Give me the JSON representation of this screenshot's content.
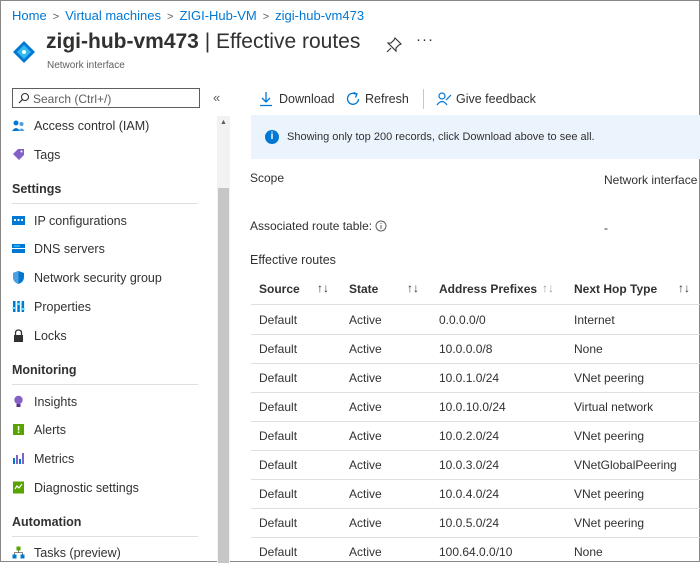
{
  "breadcrumb": [
    "Home",
    "Virtual machines",
    "ZIGI-Hub-VM",
    "zigi-hub-vm473"
  ],
  "header": {
    "resource_name": "zigi-hub-vm473",
    "blade_title": "| Effective routes",
    "subtitle": "Network interface",
    "more_label": "···"
  },
  "sidebar": {
    "search_placeholder": "Search (Ctrl+/)",
    "collapse_label": "«",
    "top_items": [
      {
        "label": "Access control (IAM)",
        "icon": "people-icon"
      },
      {
        "label": "Tags",
        "icon": "tag-icon"
      }
    ],
    "sections": [
      {
        "title": "Settings",
        "items": [
          {
            "label": "IP configurations",
            "icon": "ip-config-icon"
          },
          {
            "label": "DNS servers",
            "icon": "dns-icon"
          },
          {
            "label": "Network security group",
            "icon": "shield-icon"
          },
          {
            "label": "Properties",
            "icon": "properties-icon"
          },
          {
            "label": "Locks",
            "icon": "lock-icon"
          }
        ]
      },
      {
        "title": "Monitoring",
        "items": [
          {
            "label": "Insights",
            "icon": "lightbulb-icon"
          },
          {
            "label": "Alerts",
            "icon": "alert-icon"
          },
          {
            "label": "Metrics",
            "icon": "metrics-icon"
          },
          {
            "label": "Diagnostic settings",
            "icon": "diagnostic-icon"
          }
        ]
      },
      {
        "title": "Automation",
        "items": [
          {
            "label": "Tasks (preview)",
            "icon": "tasks-icon"
          }
        ]
      }
    ]
  },
  "toolbar": {
    "download": "Download",
    "refresh": "Refresh",
    "feedback": "Give feedback"
  },
  "info_banner": "Showing only top 200 records, click Download above to see all.",
  "scope": {
    "label": "Scope",
    "value": "Network interface",
    "route_table_label": "Associated route table:",
    "route_table_value": "-"
  },
  "table": {
    "title": "Effective routes",
    "columns": [
      "Source",
      "State",
      "Address Prefixes",
      "Next Hop Type"
    ],
    "sort_glyph": "↑↓",
    "rows": [
      [
        "Default",
        "Active",
        "0.0.0.0/0",
        "Internet"
      ],
      [
        "Default",
        "Active",
        "10.0.0.0/8",
        "None"
      ],
      [
        "Default",
        "Active",
        "10.0.1.0/24",
        "VNet peering"
      ],
      [
        "Default",
        "Active",
        "10.0.10.0/24",
        "Virtual network"
      ],
      [
        "Default",
        "Active",
        "10.0.2.0/24",
        "VNet peering"
      ],
      [
        "Default",
        "Active",
        "10.0.3.0/24",
        "VNetGlobalPeering"
      ],
      [
        "Default",
        "Active",
        "10.0.4.0/24",
        "VNet peering"
      ],
      [
        "Default",
        "Active",
        "10.0.5.0/24",
        "VNet peering"
      ],
      [
        "Default",
        "Active",
        "100.64.0.0/10",
        "None"
      ]
    ]
  },
  "colors": {
    "accent": "#0078d4",
    "banner_bg": "#ebf3fc"
  }
}
